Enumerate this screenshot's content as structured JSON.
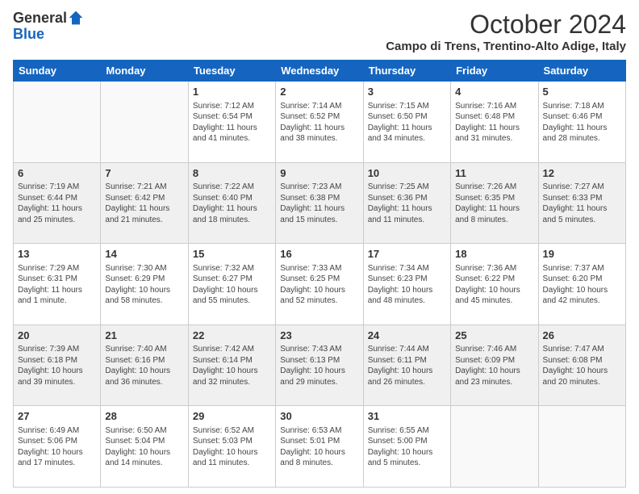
{
  "header": {
    "logo_general": "General",
    "logo_blue": "Blue",
    "main_title": "October 2024",
    "subtitle": "Campo di Trens, Trentino-Alto Adige, Italy"
  },
  "days_of_week": [
    "Sunday",
    "Monday",
    "Tuesday",
    "Wednesday",
    "Thursday",
    "Friday",
    "Saturday"
  ],
  "weeks": [
    [
      {
        "day": "",
        "sunrise": "",
        "sunset": "",
        "daylight": ""
      },
      {
        "day": "",
        "sunrise": "",
        "sunset": "",
        "daylight": ""
      },
      {
        "day": "1",
        "sunrise": "Sunrise: 7:12 AM",
        "sunset": "Sunset: 6:54 PM",
        "daylight": "Daylight: 11 hours and 41 minutes."
      },
      {
        "day": "2",
        "sunrise": "Sunrise: 7:14 AM",
        "sunset": "Sunset: 6:52 PM",
        "daylight": "Daylight: 11 hours and 38 minutes."
      },
      {
        "day": "3",
        "sunrise": "Sunrise: 7:15 AM",
        "sunset": "Sunset: 6:50 PM",
        "daylight": "Daylight: 11 hours and 34 minutes."
      },
      {
        "day": "4",
        "sunrise": "Sunrise: 7:16 AM",
        "sunset": "Sunset: 6:48 PM",
        "daylight": "Daylight: 11 hours and 31 minutes."
      },
      {
        "day": "5",
        "sunrise": "Sunrise: 7:18 AM",
        "sunset": "Sunset: 6:46 PM",
        "daylight": "Daylight: 11 hours and 28 minutes."
      }
    ],
    [
      {
        "day": "6",
        "sunrise": "Sunrise: 7:19 AM",
        "sunset": "Sunset: 6:44 PM",
        "daylight": "Daylight: 11 hours and 25 minutes."
      },
      {
        "day": "7",
        "sunrise": "Sunrise: 7:21 AM",
        "sunset": "Sunset: 6:42 PM",
        "daylight": "Daylight: 11 hours and 21 minutes."
      },
      {
        "day": "8",
        "sunrise": "Sunrise: 7:22 AM",
        "sunset": "Sunset: 6:40 PM",
        "daylight": "Daylight: 11 hours and 18 minutes."
      },
      {
        "day": "9",
        "sunrise": "Sunrise: 7:23 AM",
        "sunset": "Sunset: 6:38 PM",
        "daylight": "Daylight: 11 hours and 15 minutes."
      },
      {
        "day": "10",
        "sunrise": "Sunrise: 7:25 AM",
        "sunset": "Sunset: 6:36 PM",
        "daylight": "Daylight: 11 hours and 11 minutes."
      },
      {
        "day": "11",
        "sunrise": "Sunrise: 7:26 AM",
        "sunset": "Sunset: 6:35 PM",
        "daylight": "Daylight: 11 hours and 8 minutes."
      },
      {
        "day": "12",
        "sunrise": "Sunrise: 7:27 AM",
        "sunset": "Sunset: 6:33 PM",
        "daylight": "Daylight: 11 hours and 5 minutes."
      }
    ],
    [
      {
        "day": "13",
        "sunrise": "Sunrise: 7:29 AM",
        "sunset": "Sunset: 6:31 PM",
        "daylight": "Daylight: 11 hours and 1 minute."
      },
      {
        "day": "14",
        "sunrise": "Sunrise: 7:30 AM",
        "sunset": "Sunset: 6:29 PM",
        "daylight": "Daylight: 10 hours and 58 minutes."
      },
      {
        "day": "15",
        "sunrise": "Sunrise: 7:32 AM",
        "sunset": "Sunset: 6:27 PM",
        "daylight": "Daylight: 10 hours and 55 minutes."
      },
      {
        "day": "16",
        "sunrise": "Sunrise: 7:33 AM",
        "sunset": "Sunset: 6:25 PM",
        "daylight": "Daylight: 10 hours and 52 minutes."
      },
      {
        "day": "17",
        "sunrise": "Sunrise: 7:34 AM",
        "sunset": "Sunset: 6:23 PM",
        "daylight": "Daylight: 10 hours and 48 minutes."
      },
      {
        "day": "18",
        "sunrise": "Sunrise: 7:36 AM",
        "sunset": "Sunset: 6:22 PM",
        "daylight": "Daylight: 10 hours and 45 minutes."
      },
      {
        "day": "19",
        "sunrise": "Sunrise: 7:37 AM",
        "sunset": "Sunset: 6:20 PM",
        "daylight": "Daylight: 10 hours and 42 minutes."
      }
    ],
    [
      {
        "day": "20",
        "sunrise": "Sunrise: 7:39 AM",
        "sunset": "Sunset: 6:18 PM",
        "daylight": "Daylight: 10 hours and 39 minutes."
      },
      {
        "day": "21",
        "sunrise": "Sunrise: 7:40 AM",
        "sunset": "Sunset: 6:16 PM",
        "daylight": "Daylight: 10 hours and 36 minutes."
      },
      {
        "day": "22",
        "sunrise": "Sunrise: 7:42 AM",
        "sunset": "Sunset: 6:14 PM",
        "daylight": "Daylight: 10 hours and 32 minutes."
      },
      {
        "day": "23",
        "sunrise": "Sunrise: 7:43 AM",
        "sunset": "Sunset: 6:13 PM",
        "daylight": "Daylight: 10 hours and 29 minutes."
      },
      {
        "day": "24",
        "sunrise": "Sunrise: 7:44 AM",
        "sunset": "Sunset: 6:11 PM",
        "daylight": "Daylight: 10 hours and 26 minutes."
      },
      {
        "day": "25",
        "sunrise": "Sunrise: 7:46 AM",
        "sunset": "Sunset: 6:09 PM",
        "daylight": "Daylight: 10 hours and 23 minutes."
      },
      {
        "day": "26",
        "sunrise": "Sunrise: 7:47 AM",
        "sunset": "Sunset: 6:08 PM",
        "daylight": "Daylight: 10 hours and 20 minutes."
      }
    ],
    [
      {
        "day": "27",
        "sunrise": "Sunrise: 6:49 AM",
        "sunset": "Sunset: 5:06 PM",
        "daylight": "Daylight: 10 hours and 17 minutes."
      },
      {
        "day": "28",
        "sunrise": "Sunrise: 6:50 AM",
        "sunset": "Sunset: 5:04 PM",
        "daylight": "Daylight: 10 hours and 14 minutes."
      },
      {
        "day": "29",
        "sunrise": "Sunrise: 6:52 AM",
        "sunset": "Sunset: 5:03 PM",
        "daylight": "Daylight: 10 hours and 11 minutes."
      },
      {
        "day": "30",
        "sunrise": "Sunrise: 6:53 AM",
        "sunset": "Sunset: 5:01 PM",
        "daylight": "Daylight: 10 hours and 8 minutes."
      },
      {
        "day": "31",
        "sunrise": "Sunrise: 6:55 AM",
        "sunset": "Sunset: 5:00 PM",
        "daylight": "Daylight: 10 hours and 5 minutes."
      },
      {
        "day": "",
        "sunrise": "",
        "sunset": "",
        "daylight": ""
      },
      {
        "day": "",
        "sunrise": "",
        "sunset": "",
        "daylight": ""
      }
    ]
  ]
}
